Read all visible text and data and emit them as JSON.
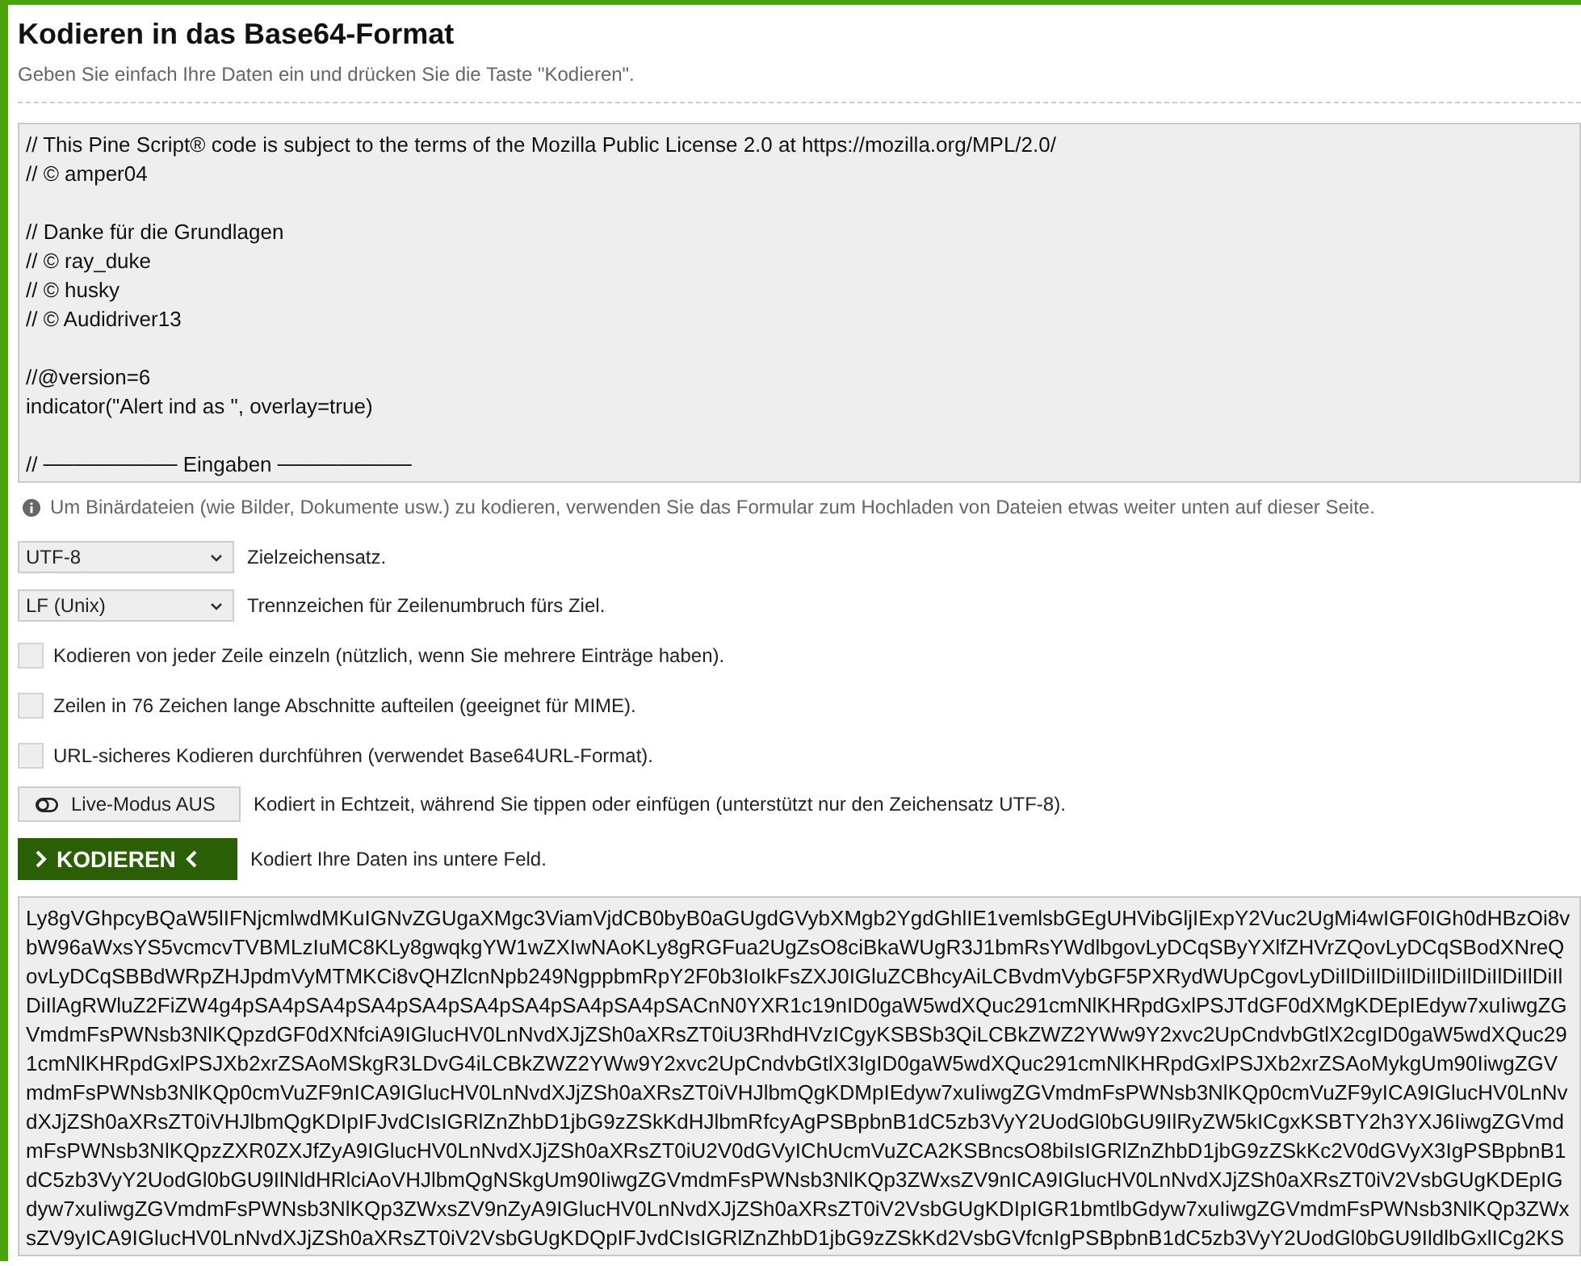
{
  "header": {
    "title": "Kodieren in das Base64-Format",
    "subtitle": "Geben Sie einfach Ihre Daten ein und drücken Sie die Taste \"Kodieren\"."
  },
  "input": {
    "value": "// This Pine Script® code is subject to the terms of the Mozilla Public License 2.0 at https://mozilla.org/MPL/2.0/\n// © amper04\n\n// Danke für die Grundlagen\n// © ray_duke\n// © husky\n// © Audidriver13\n\n//@version=6\nindicator(\"Alert ind as \", overlay=true)\n\n// ───────── Eingaben ─────────"
  },
  "info": "Um Binärdateien (wie Bilder, Dokumente usw.) zu kodieren, verwenden Sie das Formular zum Hochladen von Dateien etwas weiter unten auf dieser Seite.",
  "selects": [
    {
      "value": "UTF-8",
      "label": "Zielzeichensatz."
    },
    {
      "value": "LF (Unix)",
      "label": "Trennzeichen für Zeilenumbruch fürs Ziel."
    }
  ],
  "options": [
    {
      "label": "Kodieren von jeder Zeile einzeln (nützlich, wenn Sie mehrere Einträge haben).",
      "checked": false
    },
    {
      "label": "Zeilen in 76 Zeichen lange Abschnitte aufteilen (geeignet für MIME).",
      "checked": false
    },
    {
      "label": "URL-sicheres Kodieren durchführen (verwendet Base64URL-Format).",
      "checked": false
    }
  ],
  "live_mode": {
    "label": "Live-Modus AUS",
    "on": false,
    "description": "Kodiert in Echtzeit, während Sie tippen oder einfügen (unterstützt nur den Zeichensatz UTF-8)."
  },
  "encode": {
    "label": "KODIEREN",
    "description": "Kodiert Ihre Daten ins untere Feld."
  },
  "output": {
    "lines": [
      "Ly8gVGhpcyBQaW5lIFNjcmlwdMKuIGNvZGUgaXMgc3ViamVjdCB0byB0aGUgdGVybXMgb2YgdGhlIE1vemlsbGEgUHVibGljIExpY2Vuc2UgMi4wIGF0IGh0dHBzOi8v",
      "bW96aWxsYS5vcmcvTVBMLzIuMC8KLy8gwqkgYW1wZXIwNAoKLy8gRGFua2UgZsO8ciBkaWUgR3J1bmRsYWdlbgovLyDCqSByYXlfZHVrZQovLyDCqSBodXNreQ",
      "ovLyDCqSBBdWRpZHJpdmVyMTMKCi8vQHZlcnNpb249NgppbmRpY2F0b3IoIkFsZXJ0IGluZCBhcyAiLCBvdmVybGF5PXRydWUpCgovLyDiIlDiIlDiIlDiIlDiIlDiIlDiIlDiIl",
      "DiIlAgRWluZ2FiZW4g4pSA4pSA4pSA4pSA4pSA4pSA4pSA4pSA4pSACnN0YXR1c19nID0gaW5wdXQuc291cmNlKHRpdGxlPSJTdGF0dXMgKDEpIEdyw7xuIiwgZG",
      "VmdmFsPWNsb3NlKQpzdGF0dXNfciA9IGlucHV0LnNvdXJjZSh0aXRsZT0iU3RhdHVzICgyKSBSb3QiLCBkZWZ2YWw9Y2xvc2UpCndvbGtlX2cgID0gaW5wdXQuc29",
      "1cmNlKHRpdGxlPSJXb2xrZSAoMSkgR3LDvG4iLCBkZWZ2YWw9Y2xvc2UpCndvbGtlX3IgID0gaW5wdXQuc291cmNlKHRpdGxlPSJXb2xrZSAoMykgUm90IiwgZGV",
      "mdmFsPWNsb3NlKQp0cmVuZF9nICA9IGlucHV0LnNvdXJjZSh0aXRsZT0iVHJlbmQgKDMpIEdyw7xuIiwgZGVmdmFsPWNsb3NlKQp0cmVuZF9yICA9IGlucHV0LnNv",
      "dXJjZSh0aXRsZT0iVHJlbmQgKDIpIFJvdCIsIGRlZnZhbD1jbG9zZSkKdHJlbmRfcyAgPSBpbnB1dC5zb3VyY2UodGl0bGU9IlRyZW5kICgxKSBTY2h3YXJ6IiwgZGVmd",
      "mFsPWNsb3NlKQpzZXR0ZXJfZyA9IGlucHV0LnNvdXJjZSh0aXRsZT0iU2V0dGVyIChUcmVuZCA2KSBncsO8biIsIGRlZnZhbD1jbG9zZSkKc2V0dGVyX3IgPSBpbnB1",
      "dC5zb3VyY2UodGl0bGU9IlNldHRlciAoVHJlbmQgNSkgUm90IiwgZGVmdmFsPWNsb3NlKQp3ZWxsZV9nICA9IGlucHV0LnNvdXJjZSh0aXRsZT0iV2VsbGUgKDEpIG",
      "dyw7xuIiwgZGVmdmFsPWNsb3NlKQp3ZWxsZV9nZyA9IGlucHV0LnNvdXJjZSh0aXRsZT0iV2VsbGUgKDIpIGR1bmtlbGdyw7xuIiwgZGVmdmFsPWNsb3NlKQp3ZWx",
      "sZV9yICA9IGlucHV0LnNvdXJjZSh0aXRsZT0iV2VsbGUgKDQpIFJvdCIsIGRlZnZhbD1jbG9zZSkKd2VsbGVfcnIgPSBpbnB1dC5zb3VyY2UodGl0bGU9IldlbGxlICg2KS"
    ]
  }
}
